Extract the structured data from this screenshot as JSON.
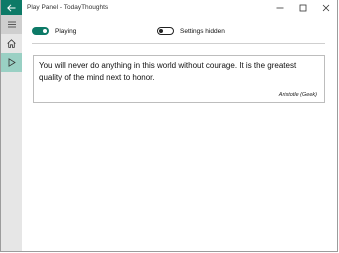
{
  "window": {
    "title": "Play Panel - TodayThoughts",
    "controls": [
      "minimize-icon",
      "maximize-icon",
      "close-icon"
    ]
  },
  "colors": {
    "accent": "#0d7a67",
    "sidebar_bg": "#e6e6e6",
    "sidebar_active": "#9ad0c4"
  },
  "sidebar": {
    "items": [
      {
        "icon": "hamburger-menu-icon"
      },
      {
        "icon": "home-icon"
      },
      {
        "icon": "play-icon",
        "active": true
      }
    ]
  },
  "toggles": {
    "playing": {
      "label": "Playing",
      "state": "on"
    },
    "settings": {
      "label": "Settings hidden",
      "state": "off"
    }
  },
  "quote": {
    "text": "You will never do anything in this world without courage. It is the greatest quality of the mind next to honor.",
    "author": "Aristotle (Geek)"
  }
}
